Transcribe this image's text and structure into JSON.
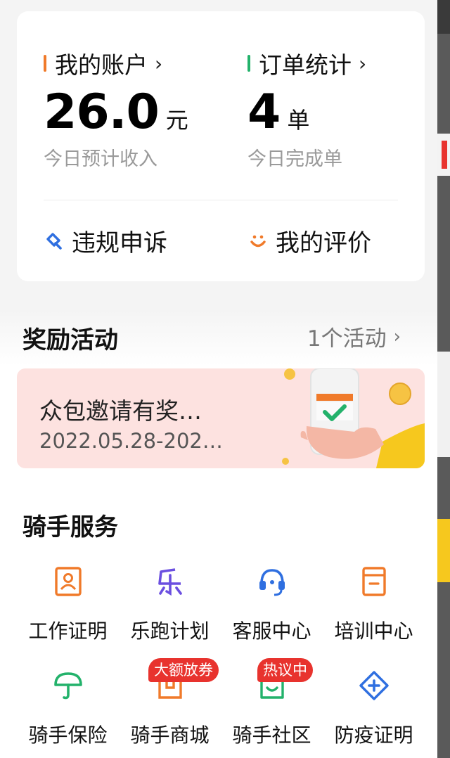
{
  "account": {
    "title": "我的账户",
    "value": "26.0",
    "unit": "元",
    "subtitle": "今日预计收入",
    "accent": "#f07a2a"
  },
  "orders": {
    "title": "订单统计",
    "value": "4",
    "unit": "单",
    "subtitle": "今日完成单",
    "accent": "#23b26b"
  },
  "links": {
    "appeal": {
      "label": "违规申诉",
      "icon": "hammer-icon"
    },
    "rating": {
      "label": "我的评价",
      "icon": "smile-icon"
    }
  },
  "rewards": {
    "title": "奖励活动",
    "more": "1个活动",
    "banner": {
      "title": "众包邀请有奖…",
      "date": "2022.05.28-202…"
    }
  },
  "services": {
    "title": "骑手服务",
    "items": [
      {
        "label": "工作证明",
        "icon": "id-card-icon"
      },
      {
        "label": "乐跑计划",
        "icon": "le-icon"
      },
      {
        "label": "客服中心",
        "icon": "headset-icon"
      },
      {
        "label": "培训中心",
        "icon": "book-icon"
      },
      {
        "label": "骑手保险",
        "icon": "umbrella-icon"
      },
      {
        "label": "骑手商城",
        "icon": "shop-icon",
        "badge": "大额放券"
      },
      {
        "label": "骑手社区",
        "icon": "house-heart-icon",
        "badge": "热议中"
      },
      {
        "label": "防疫证明",
        "icon": "medical-cross-icon"
      }
    ]
  },
  "colors": {
    "orange": "#f07a2a",
    "green": "#23b26b",
    "blue": "#2f6fe0",
    "purple": "#6b4fe0",
    "red_badge": "#e8332e",
    "banner_bg": "#fde2e0"
  }
}
